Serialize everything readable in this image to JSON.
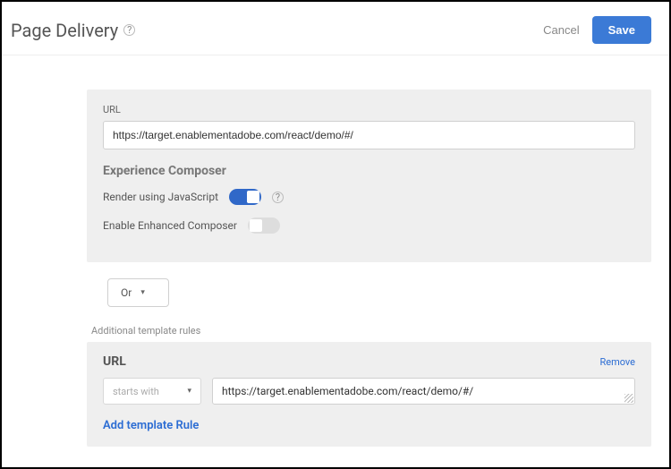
{
  "header": {
    "title": "Page Delivery",
    "cancel": "Cancel",
    "save": "Save"
  },
  "main": {
    "urlLabel": "URL",
    "urlValue": "https://target.enablementadobe.com/react/demo/#/",
    "composerTitle": "Experience Composer",
    "renderJsLabel": "Render using JavaScript",
    "enhancedLabel": "Enable Enhanced Composer"
  },
  "operator": {
    "selected": "Or"
  },
  "additional": {
    "heading": "Additional template rules",
    "ruleTitle": "URL",
    "removeLabel": "Remove",
    "matchType": "starts with",
    "ruleValue": "https://target.enablementadobe.com/react/demo/#/",
    "addRuleLabel": "Add template Rule"
  }
}
